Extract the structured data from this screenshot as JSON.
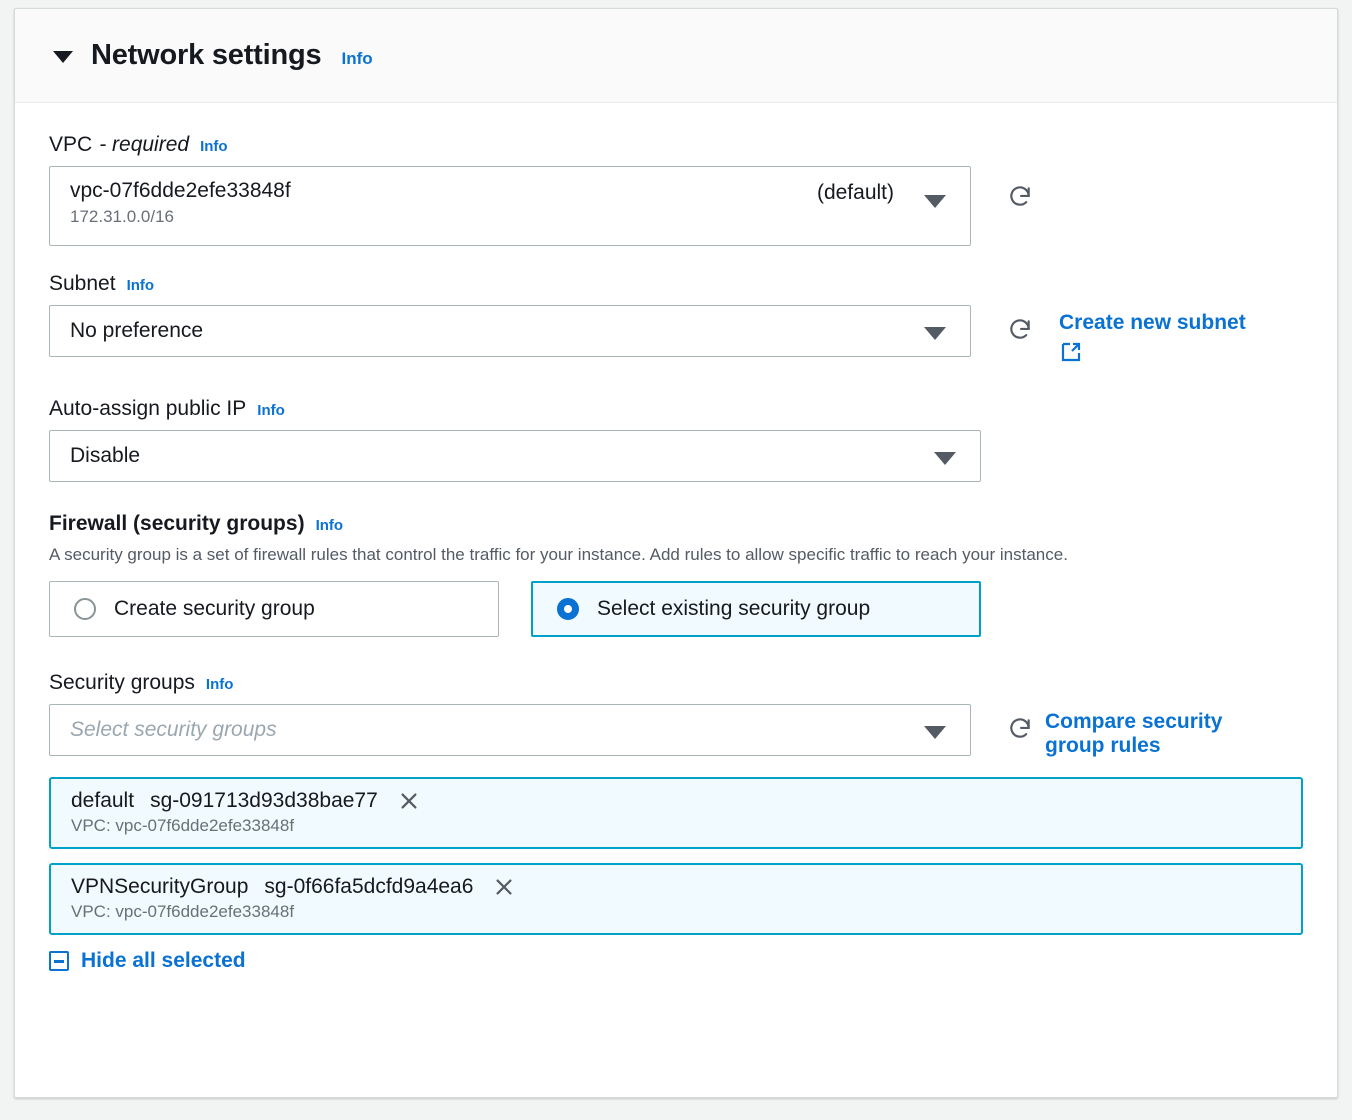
{
  "panel": {
    "title": "Network settings",
    "info_label": "Info",
    "collapse_icon": "caret-down-icon"
  },
  "vpc": {
    "label": "VPC",
    "required_suffix": "- required",
    "info_label": "Info",
    "value": "vpc-07f6dde2efe33848f",
    "cidr": "172.31.0.0/16",
    "default_tag": "(default)",
    "refresh_icon": "refresh-icon"
  },
  "subnet": {
    "label": "Subnet",
    "info_label": "Info",
    "value": "No preference",
    "refresh_icon": "refresh-icon",
    "create_link": "Create new subnet",
    "external_icon": "external-link-icon"
  },
  "auto_assign_ip": {
    "label": "Auto-assign public IP",
    "info_label": "Info",
    "value": "Disable"
  },
  "firewall": {
    "label": "Firewall (security groups)",
    "info_label": "Info",
    "description": "A security group is a set of firewall rules that control the traffic for your instance. Add rules to allow specific traffic to reach your instance.",
    "options": [
      {
        "label": "Create security group",
        "selected": false
      },
      {
        "label": "Select existing security group",
        "selected": true
      }
    ]
  },
  "security_groups": {
    "label": "Security groups",
    "info_label": "Info",
    "placeholder": "Select security groups",
    "refresh_icon": "refresh-icon",
    "compare_link_line1": "Compare security",
    "compare_link_line2": "group rules",
    "selected": [
      {
        "name": "default",
        "id": "sg-091713d93d38bae77",
        "vpc": "VPC: vpc-07f6dde2efe33848f",
        "remove_icon": "close-icon"
      },
      {
        "name": "VPNSecurityGroup",
        "id": "sg-0f66fa5dcfd9a4ea6",
        "vpc": "VPC: vpc-07f6dde2efe33848f",
        "remove_icon": "close-icon"
      }
    ],
    "hide_all_label": "Hide all selected",
    "hide_all_icon": "minus-square-icon"
  },
  "colors": {
    "link_blue": "#0972d3",
    "accent_cyan": "#00a1c9",
    "tile_selected_bg": "#f1faff",
    "border_gray": "#aab7b8",
    "text_dark": "#16191f",
    "text_muted": "#687078"
  }
}
